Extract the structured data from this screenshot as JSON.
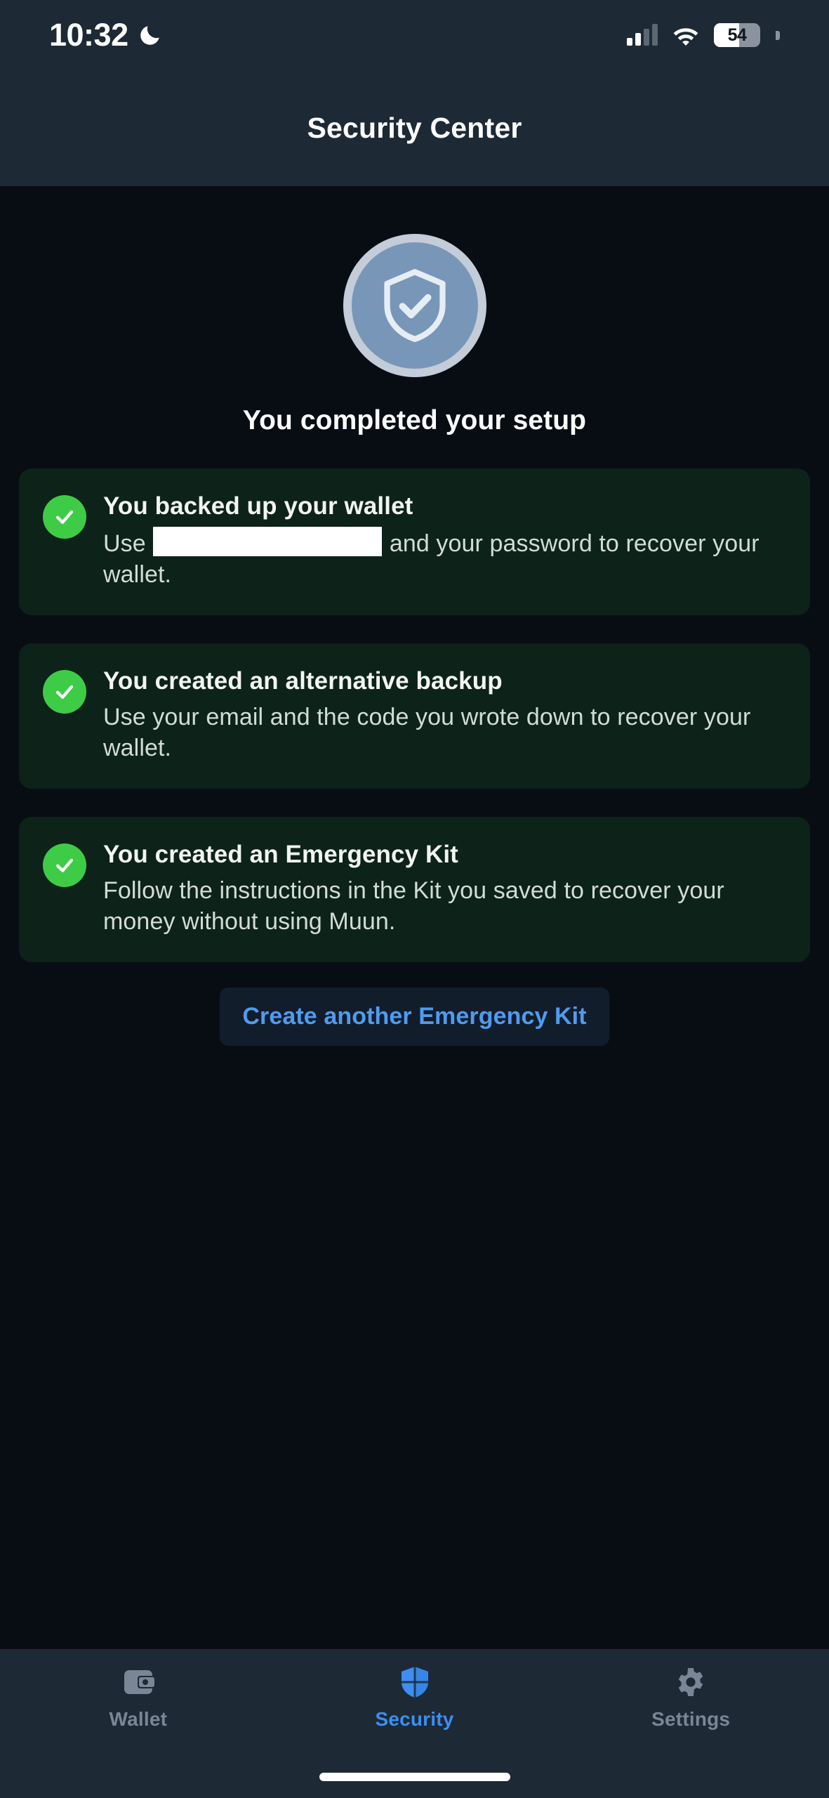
{
  "status_bar": {
    "time": "10:32",
    "dnd_icon": "crescent-moon-icon",
    "signal_icon": "cellular-signal-icon",
    "signal_bars_lit": 2,
    "signal_bars_total": 4,
    "wifi_icon": "wifi-icon",
    "battery_percent": "54",
    "battery_level": 54
  },
  "header": {
    "title": "Security Center"
  },
  "hero": {
    "icon": "shield-check-icon",
    "title": "You completed your setup",
    "circle_color": "#7896b8",
    "ring_color": "#c3ccd8"
  },
  "cards": [
    {
      "status_icon": "check-circle-icon",
      "title": "You backed up your wallet",
      "desc_before": "Use ",
      "redacted": true,
      "desc_after": " and your password to recover your wallet."
    },
    {
      "status_icon": "check-circle-icon",
      "title": "You created an alternative backup",
      "desc_before": "Use your email and the code you wrote down to recover your wallet.",
      "redacted": false,
      "desc_after": ""
    },
    {
      "status_icon": "check-circle-icon",
      "title": "You created an Emergency Kit",
      "desc_before": "Follow the instructions in the Kit you saved to recover your money without using Muun.",
      "redacted": false,
      "desc_after": ""
    }
  ],
  "cta": {
    "label": "Create another Emergency Kit",
    "text_color": "#4f9bf0",
    "background_color": "#121d2b"
  },
  "tabbar": {
    "active": "Security",
    "items": [
      {
        "label": "Wallet",
        "icon": "wallet-icon"
      },
      {
        "label": "Security",
        "icon": "shield-icon"
      },
      {
        "label": "Settings",
        "icon": "gear-icon"
      }
    ],
    "active_color": "#3d8ef0",
    "inactive_color": "#7a8695"
  },
  "colors": {
    "page_background": "#080d14",
    "chrome_background": "#1e2936",
    "card_background": "#0d2219",
    "success_green": "#3ecc47",
    "accent_blue": "#3d8ef0"
  }
}
